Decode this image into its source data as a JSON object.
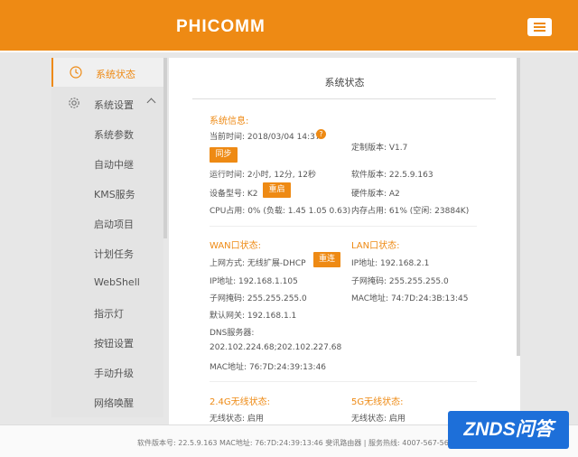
{
  "header": {
    "logo": "PHICOMM",
    "menu_icon": "hamburger-icon"
  },
  "sidebar": {
    "items": [
      {
        "label": "系统状态",
        "icon": "clock-icon",
        "active": true
      },
      {
        "label": "系统设置",
        "icon": "gear-icon",
        "expanded": true
      },
      {
        "label": "系统参数"
      },
      {
        "label": "自动中继"
      },
      {
        "label": "KMS服务"
      },
      {
        "label": "启动项目"
      },
      {
        "label": "计划任务"
      },
      {
        "label": "WebShell"
      },
      {
        "label": "指示灯"
      },
      {
        "label": "按钮设置"
      },
      {
        "label": "手动升级"
      },
      {
        "label": "网络唤醒"
      }
    ]
  },
  "panel": {
    "title": "系统状态",
    "system": {
      "heading": "系统信息:",
      "current_time": "当前时间: 2018/03/04 14:37",
      "sync_button": "同步",
      "custom_version": "定制版本: V1.7",
      "uptime": "运行时间: 2小时, 12分, 12秒",
      "software_version": "软件版本: 22.5.9.163",
      "device_model": "设备型号: K2",
      "restart_button": "重启",
      "hardware_version": "硬件版本: A2",
      "cpu_usage": "CPU占用: 0% (负载: 1.45 1.05 0.63)",
      "memory_usage": "内存占用: 61% (空闲: 23884K)"
    },
    "wan": {
      "heading": "WAN口状态:",
      "mode": "上网方式: 无线扩展-DHCP",
      "reconnect_button": "重连",
      "ip": "IP地址: 192.168.1.105",
      "mask": "子网掩码: 255.255.255.0",
      "gateway": "默认网关: 192.168.1.1",
      "dns_label": "DNS服务器:",
      "dns_value": "202.102.224.68;202.102.227.68",
      "mac": "MAC地址: 76:7D:24:39:13:46"
    },
    "lan": {
      "heading": "LAN口状态:",
      "ip": "IP地址: 192.168.2.1",
      "mask": "子网掩码: 255.255.255.0",
      "mac": "MAC地址: 74:7D:24:3B:13:45"
    },
    "wifi24": {
      "heading": "2.4G无线状态:",
      "status": "无线状态: 启用"
    },
    "wifi5": {
      "heading": "5G无线状态:",
      "status": "无线状态: 启用"
    }
  },
  "footer": {
    "text": "软件版本号: 22.5.9.163   MAC地址: 76:7D:24:39:13:46   斐讯路由器 | 服务热线: 4007-567-567"
  },
  "watermark": {
    "text": "ZNDS问答"
  },
  "colors": {
    "accent": "#ee8a14",
    "watermark": "#1d6fd9"
  }
}
